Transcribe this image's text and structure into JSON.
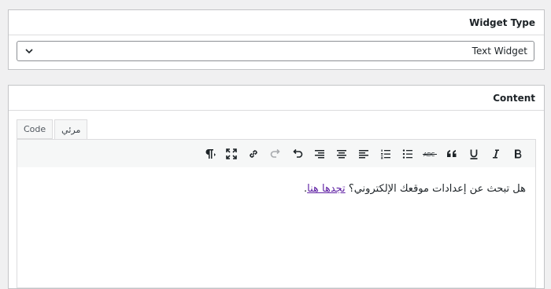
{
  "widget_type": {
    "heading": "Widget Type",
    "selected": "Text Widget"
  },
  "content": {
    "heading": "Content",
    "tabs": [
      {
        "label": "Code"
      },
      {
        "label": "مرئي"
      }
    ],
    "toolbar": [
      {
        "icon": "paragraph-icon"
      },
      {
        "icon": "fullscreen-icon"
      },
      {
        "icon": "link-icon"
      },
      {
        "icon": "redo-icon"
      },
      {
        "icon": "undo-icon"
      },
      {
        "icon": "align-right-icon"
      },
      {
        "icon": "align-center-icon"
      },
      {
        "icon": "align-left-icon"
      },
      {
        "icon": "numbered-list-icon"
      },
      {
        "icon": "bulleted-list-icon"
      },
      {
        "icon": "strikethrough-icon"
      },
      {
        "icon": "blockquote-icon"
      },
      {
        "icon": "underline-icon"
      },
      {
        "icon": "italic-icon"
      },
      {
        "icon": "bold-icon"
      }
    ],
    "editor": {
      "text": "هل تبحث عن إعدادات موقعك الإلكتروني؟ ",
      "link_text": "تجدها هنا",
      "trailing": "."
    }
  }
}
